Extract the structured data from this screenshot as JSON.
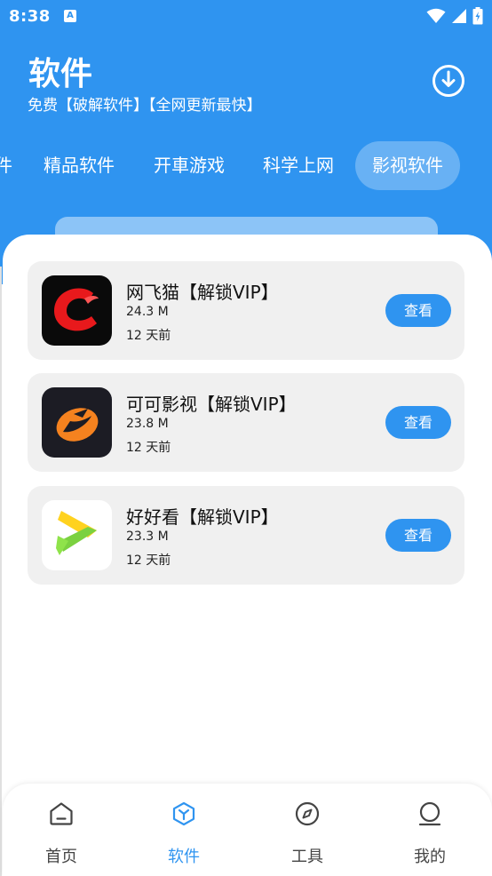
{
  "status_bar": {
    "time": "8:38",
    "notification_badge": "A",
    "icons": [
      "wifi-icon",
      "signal-icon",
      "battery-icon"
    ]
  },
  "header": {
    "title": "软件",
    "subtitle": "免费【破解软件】【全网更新最快】",
    "action_icon": "download-icon"
  },
  "tabs": [
    {
      "label": "件",
      "active": false
    },
    {
      "label": "精品软件",
      "active": false
    },
    {
      "label": "开車游戏",
      "active": false
    },
    {
      "label": "科学上网",
      "active": false
    },
    {
      "label": "影视软件",
      "active": true
    }
  ],
  "apps": [
    {
      "name": "网飞猫【解锁VIP】",
      "size": "24.3 M",
      "updated": "12 天前",
      "button": "查看",
      "icon": "netflix-cat-app-icon"
    },
    {
      "name": "可可影视【解锁VIP】",
      "size": "23.8 M",
      "updated": "12 天前",
      "button": "查看",
      "icon": "keke-video-app-icon"
    },
    {
      "name": "好好看【解锁VIP】",
      "size": "23.3 M",
      "updated": "12 天前",
      "button": "查看",
      "icon": "haohaokan-app-icon"
    }
  ],
  "bottom_nav": [
    {
      "label": "首页",
      "icon": "home-icon",
      "active": false
    },
    {
      "label": "软件",
      "icon": "cube-icon",
      "active": true
    },
    {
      "label": "工具",
      "icon": "compass-icon",
      "active": false
    },
    {
      "label": "我的",
      "icon": "user-icon",
      "active": false
    }
  ],
  "colors": {
    "primary": "#2f94f0",
    "card_bg": "#f0f0f0",
    "text": "#111111"
  }
}
